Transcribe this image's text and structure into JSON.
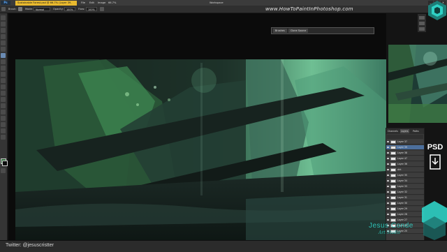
{
  "titlebar": {
    "app_icon": "Ps",
    "document_tab": "Sustainable Forest.psd @ 66.7% (Layer 39, RGB/8) *",
    "menu": [
      "File",
      "Edit",
      "Image",
      "Layer",
      "Select",
      "Filter",
      "View",
      "Window",
      "Help"
    ],
    "zoom": "66.7%",
    "workspace": "Workspace",
    "window_controls": [
      "_",
      "□",
      "×"
    ]
  },
  "options": {
    "brush_label": "Brush:",
    "mode_label": "Mode:",
    "mode_value": "Normal",
    "opacity_label": "Opacity:",
    "opacity_value": "100%",
    "flow_label": "Flow:",
    "flow_value": "100%"
  },
  "watermark": {
    "site_url": "www.HowToPaintInPhotoshop.com",
    "twitter": "Twitter: @jesuscristter",
    "brand_name": "Jesus Conde",
    "brand_sub": "Art Studio",
    "psd_label": "PSD"
  },
  "floating_tabs": [
    "Brushes",
    "Clone Source"
  ],
  "panels": {
    "tabs": [
      "Channels",
      "Layers",
      "Paths"
    ],
    "active_tab": "Layers",
    "layers": [
      {
        "name": "Layer 37",
        "active": false
      },
      {
        "name": "Layer 39",
        "active": true
      },
      {
        "name": "Layer 38",
        "active": false
      },
      {
        "name": "Layer 47",
        "active": false
      },
      {
        "name": "Layer 36",
        "active": false
      },
      {
        "name": "dirt",
        "active": false
      },
      {
        "name": "Layer 35",
        "active": false
      },
      {
        "name": "Layer 34",
        "active": false
      },
      {
        "name": "Layer 33",
        "active": false
      },
      {
        "name": "Layer 32",
        "active": false
      },
      {
        "name": "Layer 31",
        "active": false
      },
      {
        "name": "Layer 30",
        "active": false
      },
      {
        "name": "Layer 29",
        "active": false
      },
      {
        "name": "Layer 28",
        "active": false
      },
      {
        "name": "Layer 27",
        "active": false
      },
      {
        "name": "Layer 26",
        "active": false
      },
      {
        "name": "Layer 25",
        "active": false
      }
    ]
  },
  "colors": {
    "accent_yellow": "#e9ba2f",
    "brand_teal": "#2fd1c5",
    "foreground": "#2f6b3a",
    "background": "#0d0d0d"
  }
}
